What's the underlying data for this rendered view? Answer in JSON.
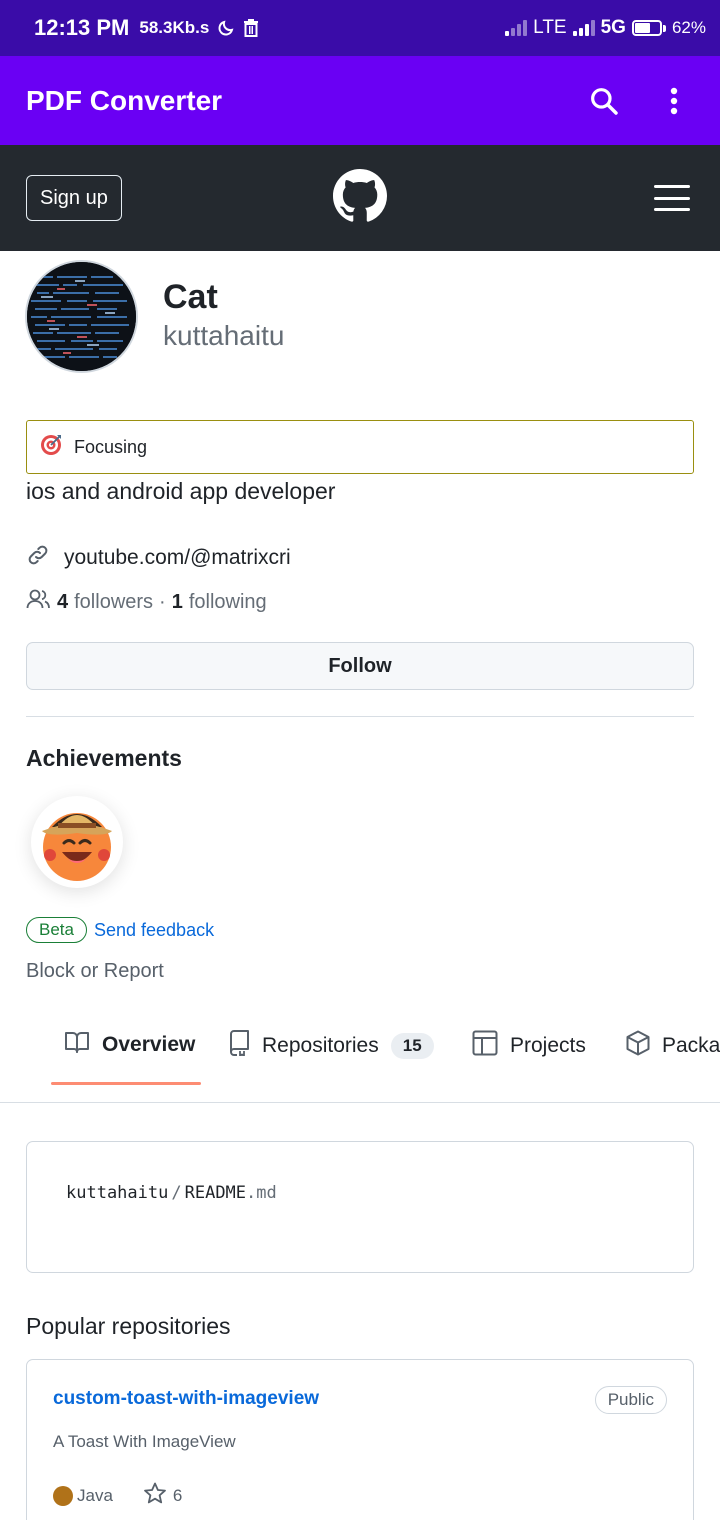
{
  "status_bar": {
    "time": "12:13 PM",
    "speed": "58.3Kb.s",
    "network_lte": "LTE",
    "network_5g": "5G",
    "battery": "62%"
  },
  "app_bar": {
    "title": "PDF Converter",
    "search_icon": "search-icon",
    "more_icon": "more-vert-icon",
    "background": "#6a00f4"
  },
  "github_header": {
    "signup_label": "Sign up",
    "logo": "github-icon",
    "menu_icon": "hamburger-icon",
    "background": "#24292f"
  },
  "profile": {
    "display_name": "Cat",
    "username": "kuttahaitu",
    "status_emoji": "direct-hit-icon",
    "status_text": "Focusing",
    "bio": "ios and android app developer",
    "website": "youtube.com/@matrixcri",
    "followers_count": "4",
    "followers_label": "followers",
    "separator": "·",
    "following_count": "1",
    "following_label": "following",
    "follow_button": "Follow"
  },
  "achievements": {
    "title": "Achievements",
    "badge_icon": "cowboy-emoji-icon",
    "beta_label": "Beta",
    "feedback_label": "Send feedback",
    "block_report": "Block or Report"
  },
  "tabs": [
    {
      "label": "Overview",
      "icon": "book-icon",
      "active": true
    },
    {
      "label": "Repositories",
      "icon": "repo-icon",
      "count": "15"
    },
    {
      "label": "Projects",
      "icon": "table-icon"
    },
    {
      "label": "Packa",
      "icon": "package-icon"
    }
  ],
  "readme": {
    "owner": "kuttahaitu",
    "slash": "/",
    "file": "README",
    "ext": ".md"
  },
  "popular": {
    "title": "Popular repositories",
    "repos": [
      {
        "name": "custom-toast-with-imageview",
        "visibility": "Public",
        "description": "A Toast With ImageView",
        "language": "Java",
        "language_color": "#b07219",
        "stars": "6"
      }
    ]
  },
  "colors": {
    "link": "#0969da",
    "beta_green": "#1a7f37",
    "tab_underline": "#fd8c73",
    "status_border": "#9a8f10"
  }
}
